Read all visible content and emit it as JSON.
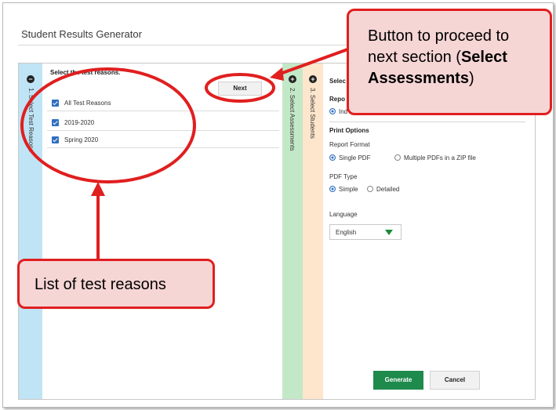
{
  "dialog": {
    "title": "Student Results Generator"
  },
  "tabs": [
    {
      "label": "1. Select Test Reasons",
      "toggle": "−"
    },
    {
      "label": "2. Select Assessments",
      "toggle": "+"
    },
    {
      "label": "3. Select Students",
      "toggle": "+"
    }
  ],
  "test_reasons": {
    "heading": "Select the test reasons.",
    "next_label": "Next",
    "items": [
      {
        "label": "All Test Reasons",
        "checked": true
      },
      {
        "label": "2019-2020",
        "checked": true
      },
      {
        "label": "Spring 2020",
        "checked": true
      }
    ]
  },
  "right_panel": {
    "heading": "Selec",
    "report_heading": "Repo",
    "report_option": "Ind",
    "print_options_heading": "Print Options",
    "report_format_label": "Report Format",
    "format_options": [
      "Single PDF",
      "Multiple PDFs in a ZIP file"
    ],
    "format_selected": "Single PDF",
    "pdf_type_label": "PDF Type",
    "pdf_type_options": [
      "Simple",
      "Detailed"
    ],
    "pdf_type_selected": "Simple",
    "language_label": "Language",
    "language_value": "English",
    "generate_label": "Generate",
    "cancel_label": "Cancel"
  },
  "callouts": {
    "next_button": {
      "line1": "Button to proceed to",
      "line2_prefix": "next section (",
      "line2_bold": "Select",
      "line3_bold": "Assessments",
      "line3_suffix": ")"
    },
    "test_reasons": "List of test reasons"
  },
  "colors": {
    "annotation_red": "#e01f1f",
    "callout_fill": "#f6d5d5",
    "tab1": "#bfe4f5",
    "tab2": "#c3e8c7",
    "tab3": "#fde6cc",
    "generate_green": "#1e8a4c",
    "checkbox_blue": "#2f6fc0"
  }
}
